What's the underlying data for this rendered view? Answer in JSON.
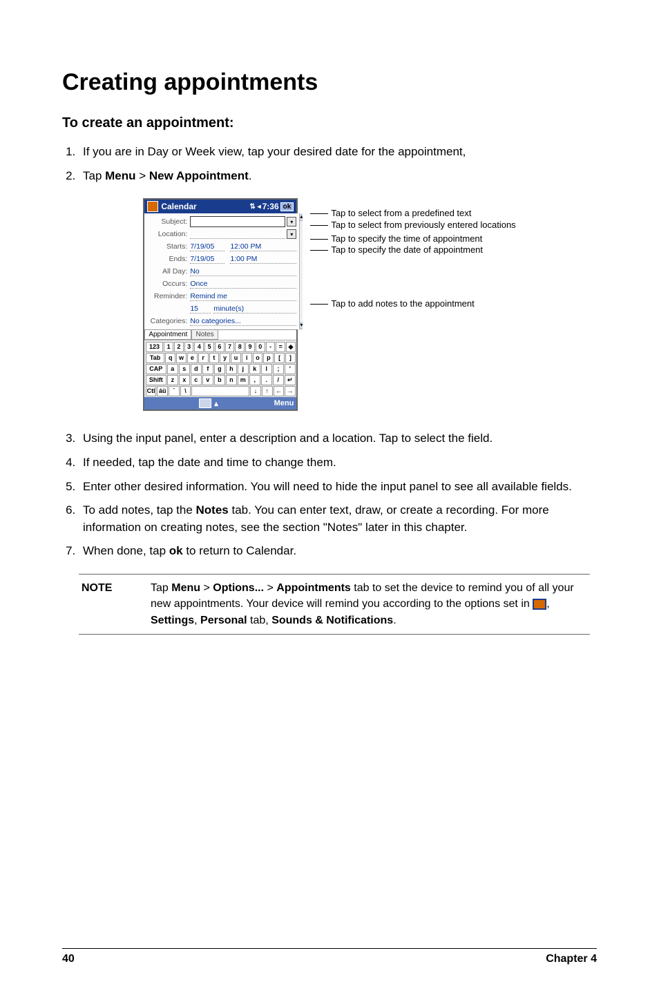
{
  "heading": "Creating appointments",
  "subheading": "To create an appointment:",
  "steps1": [
    "If you are in Day or Week view, tap your desired date for the appointment,",
    {
      "pre": "Tap ",
      "b1": "Menu",
      "gt": " > ",
      "b2": "New Appointment",
      "post": "."
    }
  ],
  "device": {
    "titlebar": {
      "title": "Calendar",
      "clock": "7:36",
      "ok": "ok"
    },
    "fields": {
      "subject_label": "Subject:",
      "subject_value": "",
      "location_label": "Location:",
      "location_value": "",
      "starts_label": "Starts:",
      "starts_date": "7/19/05",
      "starts_time": "12:00 PM",
      "ends_label": "Ends:",
      "ends_date": "7/19/05",
      "ends_time": "1:00 PM",
      "allday_label": "All Day:",
      "allday_value": "No",
      "occurs_label": "Occurs:",
      "occurs_value": "Once",
      "reminder_label": "Reminder:",
      "reminder_value": "Remind me",
      "reminder_num": "15",
      "reminder_unit": "minute(s)",
      "categories_label": "Categories:",
      "categories_value": "No categories..."
    },
    "tabs": {
      "appointment": "Appointment",
      "notes": "Notes"
    },
    "keyboard": {
      "row1": [
        "123",
        "1",
        "2",
        "3",
        "4",
        "5",
        "6",
        "7",
        "8",
        "9",
        "0",
        "-",
        "=",
        "◆"
      ],
      "row2": [
        "Tab",
        "q",
        "w",
        "e",
        "r",
        "t",
        "y",
        "u",
        "i",
        "o",
        "p",
        "[",
        "]"
      ],
      "row3": [
        "CAP",
        "a",
        "s",
        "d",
        "f",
        "g",
        "h",
        "j",
        "k",
        "l",
        ";",
        "'"
      ],
      "row4": [
        "Shift",
        "z",
        "x",
        "c",
        "v",
        "b",
        "n",
        "m",
        ",",
        ".",
        "/",
        "↵"
      ],
      "row5": [
        "Ctl",
        "áü",
        "`",
        "\\",
        " ",
        "↓",
        "↑",
        "←",
        "→"
      ]
    },
    "menubar": {
      "menu": "Menu"
    }
  },
  "callouts": {
    "c1": "Tap to select from a predefined text",
    "c2": "Tap to select from previously entered locations",
    "c3": "Tap to specify the time of appointment",
    "c4": "Tap to specify the date of appointment",
    "c5": "Tap to add notes to the appointment"
  },
  "steps2": [
    "Using the input panel, enter a description and a location. Tap to select the field.",
    "If needed, tap the date and time to change them.",
    "Enter other desired information. You will need to hide the input panel to see all available fields.",
    {
      "pre": "To add notes, tap the ",
      "b1": "Notes",
      "mid": " tab. You can enter text, draw, or create a recording. For more information on creating notes, see the section \"Notes\" later in this chapter."
    },
    {
      "pre": "When done, tap ",
      "b1": "ok",
      "mid": " to return to Calendar."
    }
  ],
  "note": {
    "label": "NOTE",
    "line1_pre": "Tap ",
    "line1_b1": "Menu",
    "gt": " > ",
    "line1_b2": "Options...",
    "line1_b3": "Appointments",
    "line1_post": " tab to set the device to remind you of all your new appointments.  Your device will remind you according to the options set in ",
    "comma": ", ",
    "line2_b1": "Settings",
    "line2_b2": "Personal",
    "line2_mid": " tab, ",
    "line2_b3": "Sounds & Notifications",
    "period": "."
  },
  "footer": {
    "page": "40",
    "chapter": "Chapter 4"
  }
}
